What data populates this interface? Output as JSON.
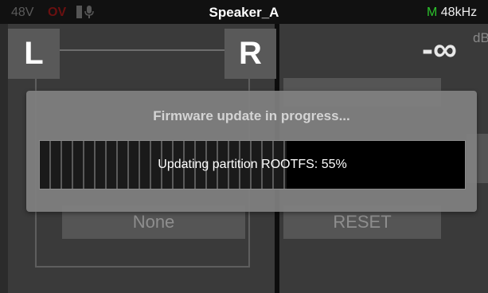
{
  "status_bar": {
    "phantom_label": "48V",
    "ov_label": "OV",
    "title": "Speaker_A",
    "rate_mode": "M",
    "sample_rate": "48kHz"
  },
  "channels": {
    "left_label": "L",
    "right_label": "R"
  },
  "meter": {
    "level": "-∞",
    "unit": "dB"
  },
  "buttons": {
    "source_label": "None",
    "reset_label": "RESET"
  },
  "modal": {
    "title": "Firmware update in progress...",
    "progress_text": "Updating partition ROOTFS: 55%",
    "progress": 0.58
  },
  "colors": {
    "status_green": "#2cc22c",
    "ov_red": "#6a1010"
  },
  "icons": {
    "lock": "lock-icon",
    "mic": "microphone-icon"
  }
}
